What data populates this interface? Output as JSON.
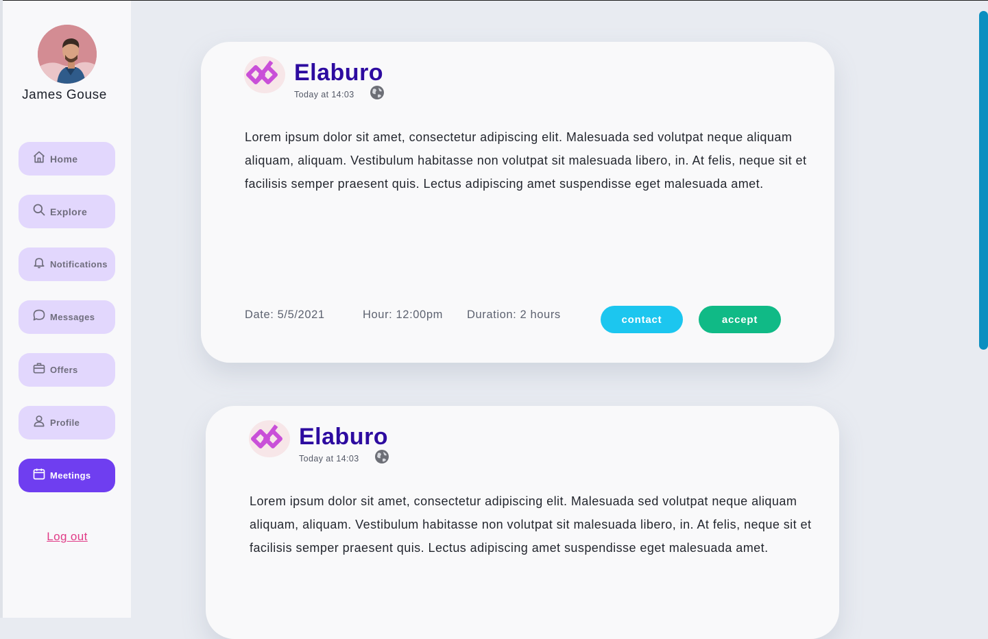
{
  "sidebar": {
    "user_name": "James Gouse",
    "nav": [
      {
        "label": "Home",
        "icon": "home-icon"
      },
      {
        "label": "Explore",
        "icon": "search-icon"
      },
      {
        "label": "Notifications",
        "icon": "bell-icon"
      },
      {
        "label": "Messages",
        "icon": "chat-bubble-icon"
      },
      {
        "label": "Offers",
        "icon": "briefcase-icon"
      },
      {
        "label": "Profile",
        "icon": "user-icon"
      },
      {
        "label": "Meetings",
        "icon": "calendar-icon",
        "active": true
      }
    ],
    "logout_label": "Log out"
  },
  "posts": [
    {
      "company": "Elaburo",
      "timestamp": "Today at 14:03",
      "body": "Lorem ipsum dolor sit amet, consectetur adipiscing elit. Malesuada sed volutpat neque aliquam aliquam, aliquam. Vestibulum habitasse non volutpat sit malesuada libero, in. At felis, neque sit et facilisis semper praesent quis. Lectus adipiscing amet suspendisse eget malesuada amet.",
      "date": "Date: 5/5/2021",
      "hour": "Hour: 12:00pm",
      "duration": "Duration: 2 hours",
      "contact_label": "contact",
      "accept_label": "accept"
    },
    {
      "company": "Elaburo",
      "timestamp": "Today at 14:03",
      "body": "Lorem ipsum dolor sit amet, consectetur adipiscing elit. Malesuada sed volutpat neque aliquam aliquam, aliquam. Vestibulum habitasse non volutpat sit malesuada libero, in. At felis, neque sit et facilisis semper praesent quis. Lectus adipiscing amet suspendisse eget malesuada amet."
    }
  ],
  "colors": {
    "accent": "#6f3ef0",
    "nav_bg": "#e2d7fd",
    "company": "#2d0ba0",
    "contact": "#1cc6ef",
    "accept": "#10ba86",
    "logout": "#e03a86",
    "scrollbar": "#0b8fc0"
  }
}
